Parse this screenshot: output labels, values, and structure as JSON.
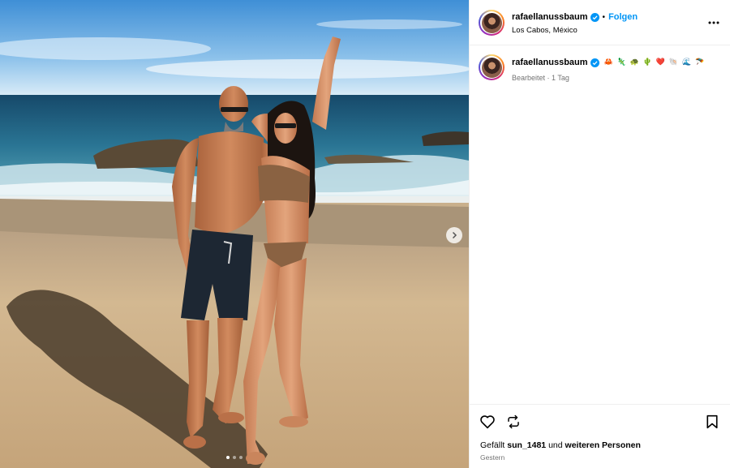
{
  "post": {
    "username": "rafaellanussbaum",
    "follow_label": "Folgen",
    "separator": "•",
    "location": "Los Cabos, México",
    "caption_emojis": "🦀 🦎 🐢 🌵 ❤️ 🐚 🌊 🪂",
    "edited_label": "Bearbeitet · 1 Tag",
    "likes_prefix": "Gefällt",
    "likes_user": "sun_1481",
    "likes_middle": "und",
    "likes_others": "weiteren Personen",
    "time_label": "Gestern",
    "carousel": {
      "count": 3,
      "active_index": 0
    }
  },
  "icons": {
    "verified": "verified-badge-icon",
    "more": "more-options-icon",
    "like": "heart-icon",
    "share": "repost-icon",
    "save": "bookmark-icon",
    "next": "chevron-right-icon"
  },
  "colors": {
    "accent": "#0095f6",
    "verified": "#0095f6",
    "muted": "#737373",
    "divider": "#efefef"
  }
}
